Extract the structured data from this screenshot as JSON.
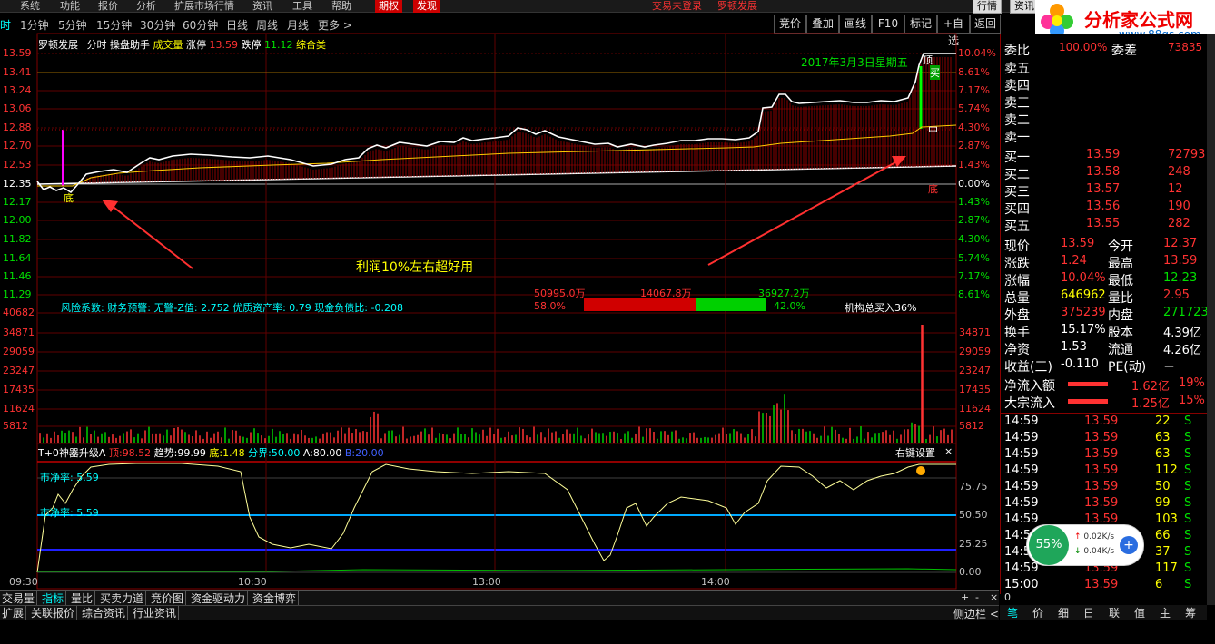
{
  "menu": [
    "系统",
    "功能",
    "报价",
    "分析",
    "扩展市场行情",
    "资讯",
    "工具",
    "帮助",
    "期权",
    "发现",
    "交易未登录",
    "罗顿发展"
  ],
  "timeframes": [
    "时",
    "1分钟",
    "5分钟",
    "15分钟",
    "30分钟",
    "60分钟",
    "日线",
    "周线",
    "月线",
    "更多 >"
  ],
  "right_buttons": [
    "竞价",
    "叠加",
    "画线",
    "F10",
    "标记",
    "+自选",
    "返回"
  ],
  "top_right_buttons": [
    "行情",
    "资讯"
  ],
  "logo": {
    "text": "分析家公式网",
    "url": "www.88gs.com"
  },
  "chart_header": {
    "stock": "罗顿发展",
    "mode": "分时",
    "helper": "操盘助手",
    "vol_label": "成交量",
    "up_label": "涨停",
    "up_val": "13.59",
    "down_label": "跌停",
    "down_val": "11.12",
    "extra": "综合类"
  },
  "date_label": "2017年3月3日星期五",
  "price_axis": [
    "13.59",
    "13.41",
    "13.24",
    "13.06",
    "12.88",
    "12.70",
    "12.53",
    "12.35",
    "12.17",
    "12.00",
    "11.82",
    "11.64",
    "11.46",
    "11.29"
  ],
  "pct_axis": [
    "10.04%",
    "8.61%",
    "7.17%",
    "5.74%",
    "4.30%",
    "2.87%",
    "1.43%",
    "0.00%",
    "1.43%",
    "2.87%",
    "4.30%",
    "5.74%",
    "7.17%",
    "8.61%"
  ],
  "vol_axis": [
    "40682",
    "34871",
    "29059",
    "23247",
    "17435",
    "11624",
    "5812"
  ],
  "ind_axis": [
    "75.75",
    "50.50",
    "25.25",
    "0.00"
  ],
  "time_axis": [
    "09:30",
    "10:30",
    "13:00",
    "14:00"
  ],
  "chart_labels": {
    "top": "顶",
    "buy": "买",
    "mid": "中",
    "bottom_right": "底",
    "bottom_left": "底"
  },
  "annotation": "利润10%左右超好用",
  "risk_bar": {
    "text": "风险系数: 财务预警: 无警-Z值: 2.752 优质资产率: 0.79 现金负债比: -0.208",
    "left_amt": "50995.0万",
    "mid_amt": "14067.8万",
    "right_amt": "36927.2万",
    "left_pct": "58.0%",
    "right_pct": "42.0%",
    "inst": "机构总买入36%"
  },
  "indicator": {
    "name": "T+0神器升级A",
    "top_label": "顶:",
    "top": "98.52",
    "trend_label": "趋势:",
    "trend": "99.99",
    "bottom_label": "底:",
    "bottom": "1.48",
    "boundary_label": "分界:",
    "boundary": "50.00",
    "a_label": "A:",
    "a": "80.00",
    "b_label": "B:",
    "b": "20.00",
    "settings": "右键设置",
    "close": "×",
    "pe1": "市净率: 5.59",
    "pe2": "市净率: 5.59"
  },
  "orderbook": {
    "wei_label": "委比",
    "wei_val": "100.00%",
    "wei_diff_label": "委差",
    "wei_diff": "73835",
    "sell": [
      {
        "label": "卖五"
      },
      {
        "label": "卖四"
      },
      {
        "label": "卖三"
      },
      {
        "label": "卖二"
      },
      {
        "label": "卖一"
      }
    ],
    "buy": [
      {
        "label": "买一",
        "price": "13.59",
        "vol": "72793"
      },
      {
        "label": "买二",
        "price": "13.58",
        "vol": "248"
      },
      {
        "label": "买三",
        "price": "13.57",
        "vol": "12"
      },
      {
        "label": "买四",
        "price": "13.56",
        "vol": "190"
      },
      {
        "label": "买五",
        "price": "13.55",
        "vol": "282"
      }
    ]
  },
  "quote": [
    {
      "l1": "现价",
      "v1": "13.59",
      "l2": "今开",
      "v2": "12.37",
      "c1": "red",
      "c2": "red"
    },
    {
      "l1": "涨跌",
      "v1": "1.24",
      "l2": "最高",
      "v2": "13.59",
      "c1": "red",
      "c2": "red"
    },
    {
      "l1": "涨幅",
      "v1": "10.04%",
      "l2": "最低",
      "v2": "12.23",
      "c1": "red",
      "c2": "grn"
    },
    {
      "l1": "总量",
      "v1": "646962",
      "l2": "量比",
      "v2": "2.95",
      "c1": "yel",
      "c2": "red"
    },
    {
      "l1": "外盘",
      "v1": "375239",
      "l2": "内盘",
      "v2": "271723",
      "c1": "red",
      "c2": "grn"
    },
    {
      "l1": "换手",
      "v1": "15.17%",
      "l2": "股本",
      "v2": "4.39亿",
      "c1": "wht",
      "c2": "wht"
    },
    {
      "l1": "净资",
      "v1": "1.53",
      "l2": "流通",
      "v2": "4.26亿",
      "c1": "wht",
      "c2": "wht"
    },
    {
      "l1": "收益(三)",
      "v1": "-0.110",
      "l2": "PE(动)",
      "v2": "－",
      "c1": "wht",
      "c2": "wht"
    }
  ],
  "flow": [
    {
      "label": "净流入额",
      "val": "1.62亿",
      "pct": "19%"
    },
    {
      "label": "大宗流入",
      "val": "1.25亿",
      "pct": "15%"
    }
  ],
  "ticks": [
    {
      "t": "14:59",
      "p": "13.59",
      "v": "22",
      "s": "S"
    },
    {
      "t": "14:59",
      "p": "13.59",
      "v": "63",
      "s": "S"
    },
    {
      "t": "14:59",
      "p": "13.59",
      "v": "63",
      "s": "S"
    },
    {
      "t": "14:59",
      "p": "13.59",
      "v": "112",
      "s": "S"
    },
    {
      "t": "14:59",
      "p": "13.59",
      "v": "50",
      "s": "S"
    },
    {
      "t": "14:59",
      "p": "13.59",
      "v": "99",
      "s": "S"
    },
    {
      "t": "14:59",
      "p": "13.59",
      "v": "103",
      "s": "S"
    },
    {
      "t": "14:59",
      "p": "13.59",
      "v": "66",
      "s": "S"
    },
    {
      "t": "14:59",
      "p": "13.59",
      "v": "37",
      "s": "S"
    },
    {
      "t": "14:59",
      "p": "13.59",
      "v": "117",
      "s": "S"
    },
    {
      "t": "15:00",
      "p": "13.59",
      "v": "6",
      "s": "S"
    }
  ],
  "net": {
    "pct": "55%",
    "up": "0.02K/s",
    "down": "0.04K/s"
  },
  "bottom_tabs": [
    "交易量",
    "指标",
    "量比",
    "买卖力道",
    "竞价图",
    "资金驱动力",
    "资金博弈"
  ],
  "bottom_tabs2": [
    "扩展",
    "关联报价",
    "综合资讯",
    "行业资讯"
  ],
  "bottom_right_ctrl": [
    "+",
    "-",
    "×",
    "0"
  ],
  "side_label": "侧边栏 <",
  "right_tabs": [
    "笔",
    "价",
    "细",
    "日",
    "联",
    "值",
    "主",
    "筹"
  ],
  "colors": {
    "up": "#ff3232",
    "down": "#00e000",
    "bg": "#000000",
    "grid": "#800000",
    "yellow": "#ffff00"
  }
}
